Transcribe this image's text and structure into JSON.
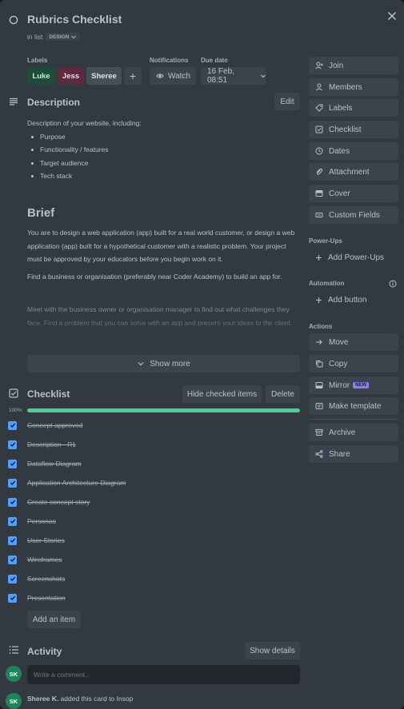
{
  "card": {
    "title": "Rubrics Checklist",
    "list_prefix": "in list",
    "list_name": "DESIGN"
  },
  "labels": {
    "heading": "Labels",
    "items": [
      {
        "text": "Luke",
        "bg": "#1f4b3a",
        "fg": "#baf3db"
      },
      {
        "text": "Jess",
        "bg": "#5b2c3f",
        "fg": "#fdd0ec"
      },
      {
        "text": "Sheree",
        "bg": "#454f59",
        "fg": "#dee4ea"
      }
    ],
    "add": "+"
  },
  "notifications": {
    "heading": "Notifications",
    "watch": "Watch"
  },
  "due": {
    "heading": "Due date",
    "value": "16 Feb, 08:51"
  },
  "description": {
    "heading": "Description",
    "edit": "Edit",
    "intro": "Description of your website, including:",
    "bullets": [
      "Purpose",
      "Functionality / features",
      "Target audience",
      "Tech stack"
    ],
    "brief_heading": "Brief",
    "p1": "You are to design a web application (app) built for a real world customer, or design a web application (app) built for a hypothetical customer with a realistic problem. Your project must be approved by your educators before you begin work on it.",
    "p2": "Find a business or organisation (preferably near Coder Academy) to build an app for.",
    "p3": "Meet with the business owner or organisation manager to find out what challenges they face. Find a problem that you can solve with an app and present your ideas to the client.",
    "show_more": "Show more"
  },
  "checklist": {
    "heading": "Checklist",
    "hide_checked": "Hide checked items",
    "delete": "Delete",
    "progress_label": "100%",
    "progress": 1.0,
    "items": [
      "Concept approved",
      "Description - R1",
      "Dataflow Diagram",
      "Application Architecture Diagram",
      "Create concept story",
      "Personas",
      "User Stories",
      "Wireframes",
      "Screenshots",
      "Presentation"
    ],
    "add_item": "Add an item"
  },
  "activity": {
    "heading": "Activity",
    "show_details": "Show details",
    "comment_placeholder": "Write a comment...",
    "avatar": "SK",
    "entry_user": "Sheree K.",
    "entry_text": " added this card to Insop"
  },
  "sidebar": {
    "join": "Join",
    "members": "Members",
    "labels": "Labels",
    "checklist": "Checklist",
    "dates": "Dates",
    "attachment": "Attachment",
    "cover": "Cover",
    "custom_fields": "Custom Fields",
    "powerups_heading": "Power-Ups",
    "add_powerups": "Add Power-Ups",
    "automation_heading": "Automation",
    "add_button": "Add button",
    "actions_heading": "Actions",
    "move": "Move",
    "copy": "Copy",
    "mirror": "Mirror",
    "mirror_badge": "NEW",
    "make_template": "Make template",
    "archive": "Archive",
    "share": "Share"
  },
  "colors": {
    "accent": "#579dff",
    "progress": "#4bce97",
    "badge": "#8f7ee7",
    "avatar": "#1f845a"
  }
}
